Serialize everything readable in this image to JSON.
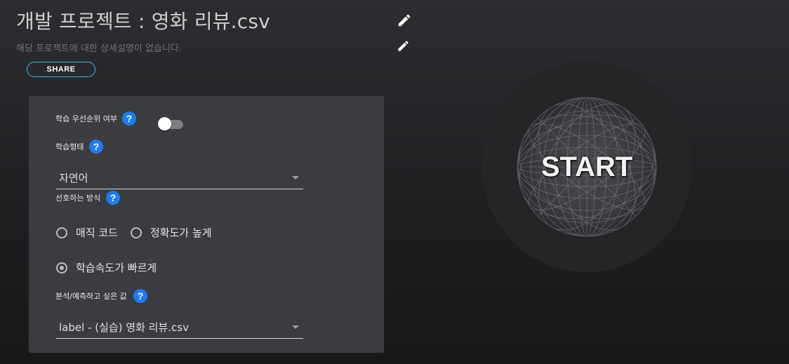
{
  "header": {
    "title": "개발 프로젝트 : 영화 리뷰.csv",
    "description": "해당 프로젝트에 대한 상세설명이 없습니다.",
    "share_label": "SHARE",
    "title_edit_icon": "pencil-icon",
    "description_edit_icon": "pencil-icon"
  },
  "form": {
    "priority": {
      "label": "학습 우선순위 여부",
      "help": "?",
      "enabled": false
    },
    "learning_type": {
      "label": "학습형태",
      "help": "?",
      "value": "자연어"
    },
    "preferred_method": {
      "label": "선호하는 방식",
      "help": "?",
      "options": [
        "매직 코드",
        "정확도가 높게",
        "학습속도가 빠르게"
      ],
      "selected": "학습속도가 빠르게"
    },
    "target_value": {
      "label": "분석/예측하고 싶은 값",
      "help": "?",
      "value": "label - (실습) 영화 리뷰.csv"
    }
  },
  "start_button": {
    "label": "START"
  },
  "colors": {
    "accent_blue": "#1e7bf0",
    "share_border": "#3fb7e3",
    "panel_bg": "#3a3c40"
  }
}
